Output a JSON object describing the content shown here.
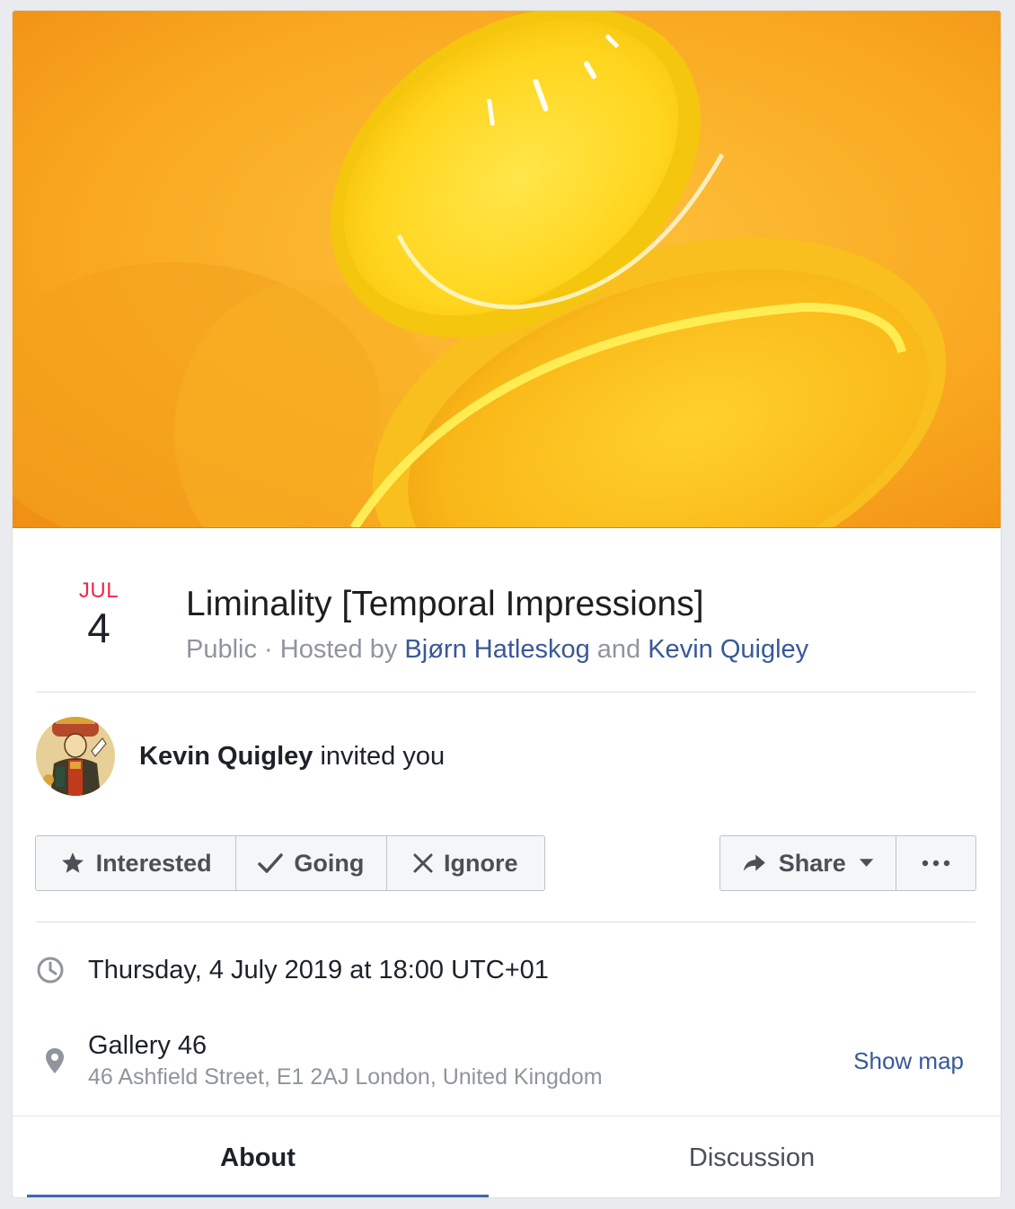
{
  "event": {
    "date": {
      "month": "JUL",
      "day": "4"
    },
    "title": "Liminality [Temporal Impressions]",
    "subtitle": {
      "privacy": "Public",
      "separator": " · Hosted by ",
      "host1": "Bjørn Hatleskog",
      "and": " and ",
      "host2": "Kevin Quigley"
    },
    "invite": {
      "name": "Kevin Quigley",
      "text": " invited you"
    },
    "buttons": {
      "interested": "Interested",
      "going": "Going",
      "ignore": "Ignore",
      "share": "Share"
    },
    "datetime": "Thursday, 4 July 2019 at 18:00 UTC+01",
    "location": {
      "name": "Gallery 46",
      "address": "46 Ashfield Street, E1 2AJ London, United Kingdom",
      "show_map": "Show map"
    },
    "tabs": {
      "about": "About",
      "discussion": "Discussion"
    }
  },
  "icons": {
    "interested": "star-icon",
    "going": "check-icon",
    "ignore": "x-icon",
    "share": "share-arrow-icon",
    "share_menu": "caret-down-icon",
    "more": "ellipsis-icon",
    "datetime": "clock-icon",
    "location": "map-pin-icon"
  },
  "colors": {
    "link": "#385898",
    "month": "#f02849",
    "tab_accent": "#4267b2",
    "cover_primary": "#f7a21a",
    "cover_spoon": "#ffe033"
  }
}
